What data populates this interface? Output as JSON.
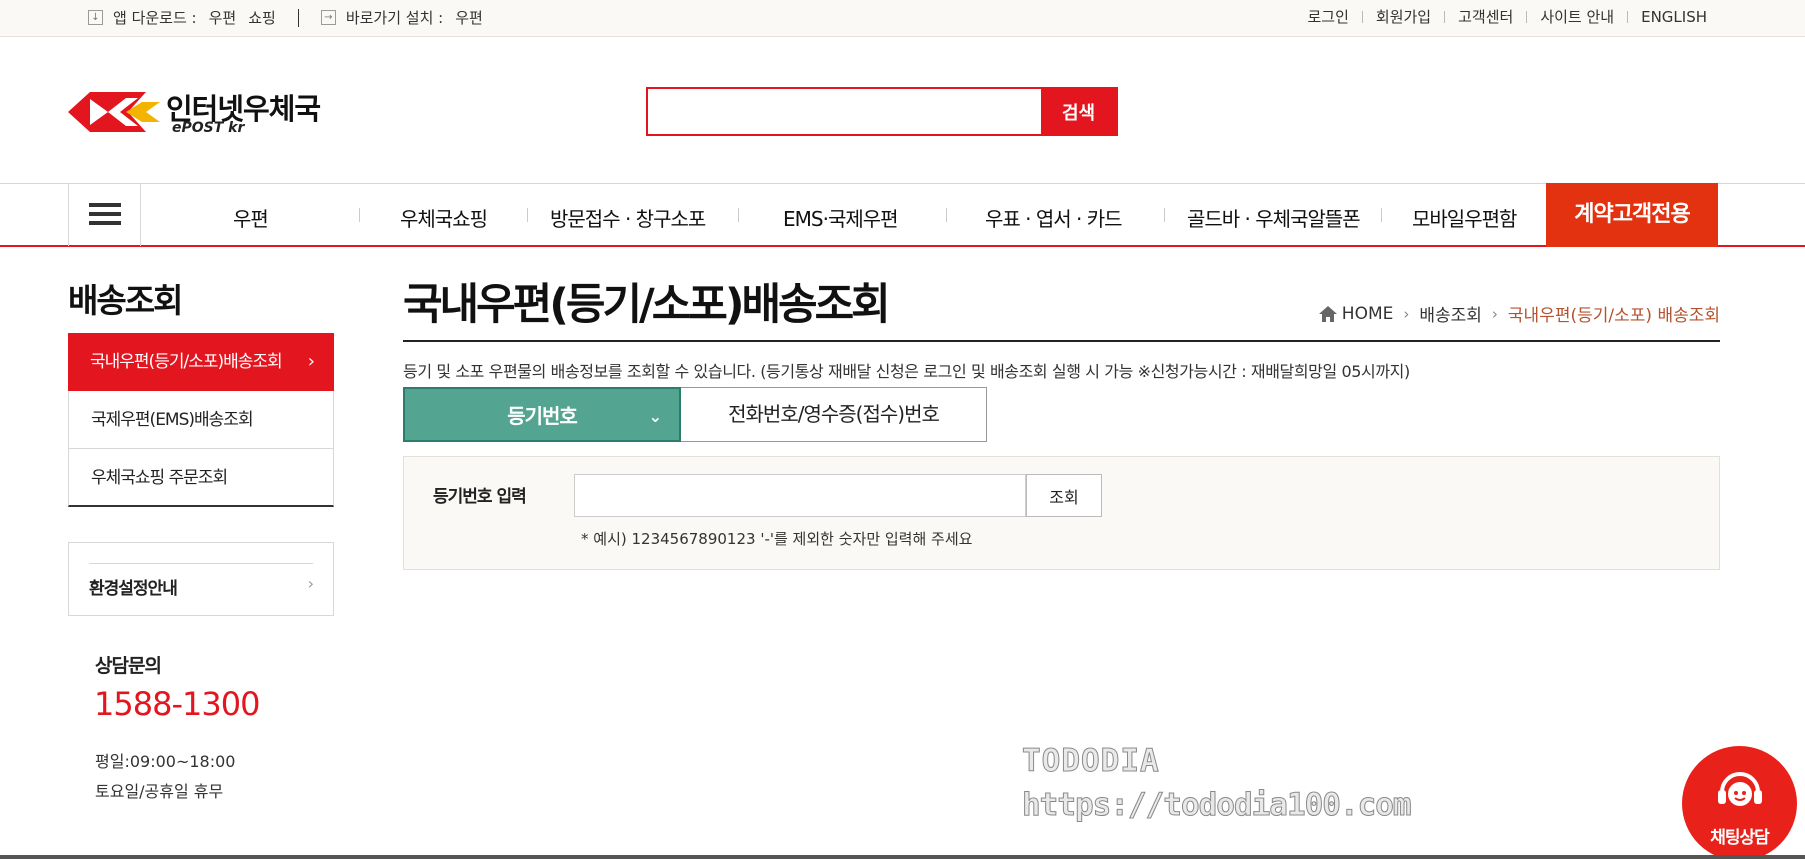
{
  "topbar": {
    "app_download_label": "앱 다운로드 :",
    "app_links": [
      "우편",
      "쇼핑"
    ],
    "shortcut_label": "바로가기 설치 :",
    "shortcut_link": "우편",
    "right_links": [
      "로그인",
      "회원가입",
      "고객센터",
      "사이트 안내",
      "ENGLISH"
    ]
  },
  "header": {
    "logo_korean": "인터넷우체국",
    "logo_english": "ePOST kr",
    "search_placeholder": "",
    "search_button": "검색"
  },
  "gnb": {
    "items": [
      "우편",
      "우체국쇼핑",
      "방문접수 · 창구소포",
      "EMS·국제우편",
      "우표 · 엽서 · 카드",
      "골드바 · 우체국알뜰폰",
      "모바일우편함"
    ],
    "special": "계약고객전용"
  },
  "sidebar": {
    "title": "배송조회",
    "items": [
      {
        "label": "국내우편(등기/소포)배송조회",
        "active": true
      },
      {
        "label": "국제우편(EMS)배송조회",
        "active": false
      },
      {
        "label": "우체국쇼핑 주문조회",
        "active": false
      }
    ],
    "env_guide": "환경설정안내",
    "consult_title": "상담문의",
    "consult_phone": "1588-1300",
    "hours_weekday": "평일:09:00~18:00",
    "hours_weekend": "토요일/공휴일 휴무"
  },
  "main": {
    "page_title": "국내우편(등기/소포)배송조회",
    "breadcrumb": [
      "HOME",
      "배송조회",
      "국내우편(등기/소포) 배송조회"
    ],
    "description": "등기 및 소포 우편물의 배송정보를 조회할 수 있습니다. (등기통상 재배달 신청은 로그인 및 배송조회 실행 시 가능 ※신청가능시간 : 재배달희망일 05시까지)",
    "tab_active": "등기번호",
    "tab_other": "전화번호/영수증(접수)번호",
    "input_label": "등기번호 입력",
    "input_value": "",
    "query_button": "조회",
    "note": "* 예시) 1234567890123 '-'를 제외한 숫자만 입력해 주세요"
  },
  "watermark": {
    "line1": "TODODIA",
    "line2": "https://tododia100.com"
  },
  "chat": {
    "label": "채팅상담"
  },
  "colors": {
    "brand_red": "#e3151f",
    "tab_green": "#53a592",
    "vip_orange": "#e3320f",
    "breadcrumb_current": "#b5522d"
  }
}
